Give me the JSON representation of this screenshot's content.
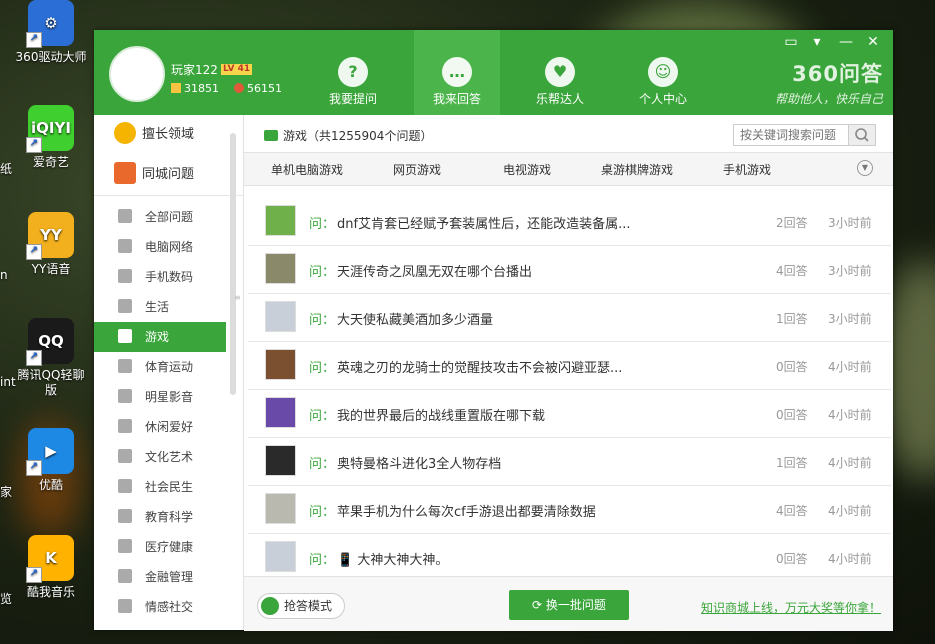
{
  "desktop": {
    "icons": [
      {
        "label": "360驱动大师",
        "color": "#2b6fd6",
        "glyph": "⚙"
      },
      {
        "label": "爱奇艺",
        "color": "#3fcf2f",
        "glyph": "iQIYI"
      },
      {
        "label": "YY语音",
        "color": "#f2b01e",
        "glyph": "YY"
      },
      {
        "label": "腾讯QQ轻聊版",
        "color": "#1a1a1a",
        "glyph": "QQ"
      },
      {
        "label": "优酷",
        "color": "#1e88e5",
        "glyph": "▶"
      },
      {
        "label": "酷我音乐",
        "color": "#ffb300",
        "glyph": "K"
      }
    ],
    "edge_labels": [
      "纸",
      "n",
      "int",
      "家",
      "览"
    ]
  },
  "window": {
    "user": {
      "name": "玩家122",
      "level": "LV 41",
      "coins": "31851",
      "points": "56151"
    },
    "nav_tabs": [
      {
        "label": "我要提问",
        "glyph": "?"
      },
      {
        "label": "我来回答",
        "glyph": "…"
      },
      {
        "label": "乐帮达人",
        "glyph": "♥"
      },
      {
        "label": "个人中心",
        "glyph": "☺"
      }
    ],
    "brand": {
      "title": "360问答",
      "slogan": "帮助他人，快乐自己"
    },
    "controls": {
      "menu": "▭",
      "dropdown": "▾",
      "minimize": "—",
      "close": "✕"
    }
  },
  "sidebar": {
    "featured": [
      {
        "label": "擅长领域",
        "icon": "star-icon",
        "color": "#f5b400"
      },
      {
        "label": "同城问题",
        "icon": "house-icon",
        "color": "#e8692b"
      }
    ],
    "items": [
      {
        "label": "全部问题",
        "icon": "grid-icon"
      },
      {
        "label": "电脑网络",
        "icon": "monitor-icon"
      },
      {
        "label": "手机数码",
        "icon": "phone-icon"
      },
      {
        "label": "生活",
        "icon": "umbrella-icon"
      },
      {
        "label": "游戏",
        "icon": "gamepad-icon"
      },
      {
        "label": "体育运动",
        "icon": "dumbbell-icon"
      },
      {
        "label": "明星影音",
        "icon": "star-outline-icon"
      },
      {
        "label": "休闲爱好",
        "icon": "cup-icon"
      },
      {
        "label": "文化艺术",
        "icon": "music-icon"
      },
      {
        "label": "社会民生",
        "icon": "chat-icon"
      },
      {
        "label": "教育科学",
        "icon": "flask-icon"
      },
      {
        "label": "医疗健康",
        "icon": "medical-icon"
      },
      {
        "label": "金融管理",
        "icon": "yen-icon"
      },
      {
        "label": "情感社交",
        "icon": "heart-icon"
      }
    ]
  },
  "main": {
    "breadcrumb": "游戏（共1255904个问题）",
    "search_placeholder": "按关键词搜索问题",
    "subtabs": [
      "单机电脑游戏",
      "网页游戏",
      "电视游戏",
      "桌游棋牌游戏",
      "手机游戏"
    ],
    "question_prefix": "问：",
    "questions": [
      {
        "text": "dnf艾肯套已经赋予套装属性后，还能改造装备属...",
        "answers": "2回答",
        "time": "3小时前",
        "thumb": "#6fb04a"
      },
      {
        "text": "天涯传奇之凤凰无双在哪个台播出",
        "answers": "4回答",
        "time": "3小时前",
        "thumb": "#8a8a6a"
      },
      {
        "text": "大天使私藏美酒加多少酒量",
        "answers": "1回答",
        "time": "3小时前",
        "thumb": "#c9cfd8"
      },
      {
        "text": "英魂之刃的龙骑士的觉醒技攻击不会被闪避亚瑟...",
        "answers": "0回答",
        "time": "4小时前",
        "thumb": "#7a5030"
      },
      {
        "text": "我的世界最后的战线重置版在哪下载",
        "answers": "0回答",
        "time": "4小时前",
        "thumb": "#6a4aa8"
      },
      {
        "text": "奥特曼格斗进化3全人物存档",
        "answers": "1回答",
        "time": "4小时前",
        "thumb": "#2a2a2a"
      },
      {
        "text": "苹果手机为什么每次cf手游退出都要清除数据",
        "answers": "4回答",
        "time": "4小时前",
        "thumb": "#b9b9b0"
      },
      {
        "text": "📱 大神大神大神。",
        "answers": "0回答",
        "time": "4小时前",
        "thumb": "#c9cfd8"
      }
    ],
    "mode_button": "抢答模式",
    "refresh_button": "换一批问题",
    "promo_link": "知识商城上线，万元大奖等你拿！"
  }
}
